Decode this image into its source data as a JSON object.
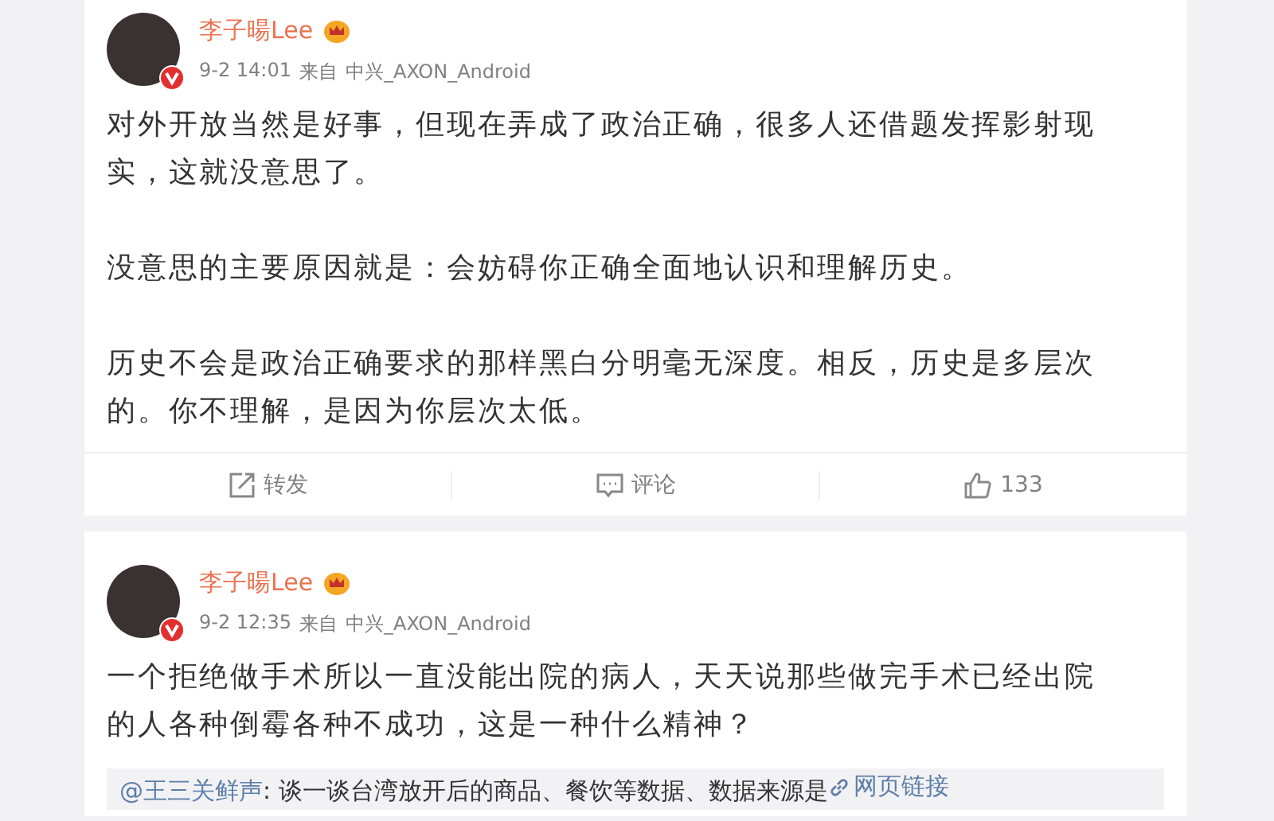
{
  "posts": [
    {
      "author": "李子暘Lee",
      "time": "9-2 14:01",
      "source_prefix": "来自",
      "source": "中兴_AXON_Android",
      "verified": true,
      "paragraphs": [
        "对外开放当然是好事，但现在弄成了政治正确，很多人还借题发挥影射现实，这就没意思了。",
        "没意思的主要原因就是：会妨碍你正确全面地认识和理解历史。",
        "历史不会是政治正确要求的那样黑白分明毫无深度。相反，历史是多层次的。你不理解，是因为你层次太低。"
      ],
      "actions": {
        "repost": "转发",
        "comment": "评论",
        "like": "133"
      }
    },
    {
      "author": "李子暘Lee",
      "time": "9-2 12:35",
      "source_prefix": "来自",
      "source": "中兴_AXON_Android",
      "verified": true,
      "paragraphs": [
        "一个拒绝做手术所以一直没能出院的病人，天天说那些做完手术已经出院的人各种倒霉各种不成功，这是一种什么精神？"
      ],
      "quote": {
        "user": "@王三关鲜声",
        "text": ": 谈一谈台湾放开后的商品、餐饮等数据、数据来源是",
        "link": "网页链接"
      }
    }
  ]
}
